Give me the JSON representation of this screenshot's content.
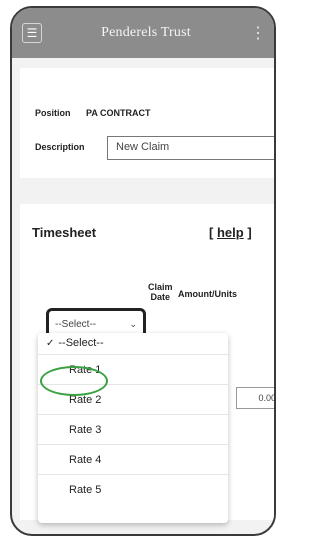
{
  "header": {
    "brand": "Penderels Trust",
    "menu_glyph": "☰",
    "kebab_glyph": "⋮"
  },
  "details": {
    "position_label": "Position",
    "position_value": "PA CONTRACT",
    "description_label": "Description",
    "description_value": "New Claim"
  },
  "timesheet": {
    "title": "Timesheet",
    "help_open": "[",
    "help_label": "help",
    "help_close": "]",
    "claim_date_line1": "Claim",
    "claim_date_line2": "Date",
    "amount_header": "Amount/Units",
    "amount_value": "0.00"
  },
  "rate_select": {
    "value": "--Select--",
    "chevron": "⌄",
    "options": [
      "--Select--",
      "Rate 1",
      "Rate 2",
      "Rate 3",
      "Rate 4",
      "Rate 5"
    ],
    "check_glyph": "✓"
  },
  "colors": {
    "topbar": "#8c8c8c",
    "highlight_circle": "#3aa243"
  }
}
